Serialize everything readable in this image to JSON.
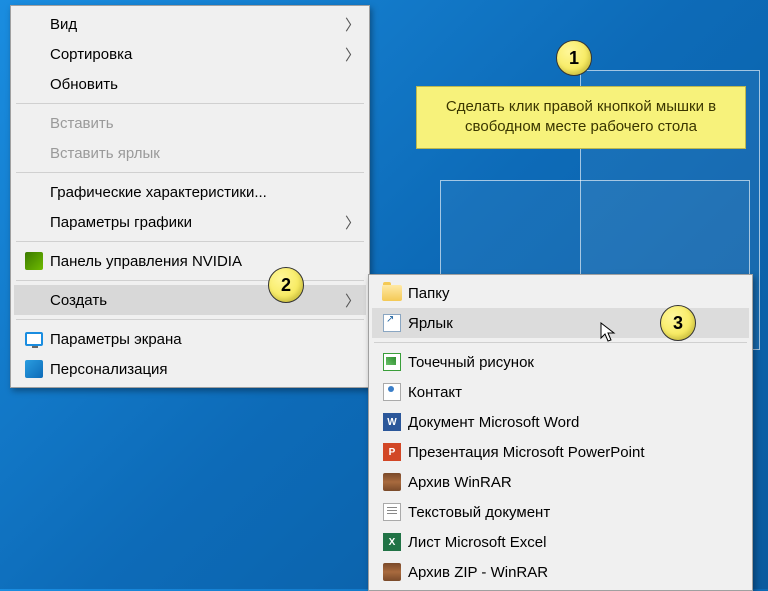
{
  "callout": {
    "text": "Сделать клик правой кнопкой мышки в свободном месте рабочего стола"
  },
  "badges": {
    "b1": "1",
    "b2": "2",
    "b3": "3"
  },
  "menu1": {
    "view": "Вид",
    "sort": "Сортировка",
    "refresh": "Обновить",
    "paste": "Вставить",
    "paste_shortcut": "Вставить ярлык",
    "gfx_props": "Графические характеристики...",
    "gfx_params": "Параметры графики",
    "nvidia": "Панель управления NVIDIA",
    "create": "Создать",
    "display_settings": "Параметры экрана",
    "personalize": "Персонализация"
  },
  "menu2": {
    "folder": "Папку",
    "shortcut": "Ярлык",
    "bmp": "Точечный рисунок",
    "contact": "Контакт",
    "word": "Документ Microsoft Word",
    "ppt": "Презентация Microsoft PowerPoint",
    "rar": "Архив WinRAR",
    "txt": "Текстовый документ",
    "excel": "Лист Microsoft Excel",
    "zip": "Архив ZIP - WinRAR"
  }
}
